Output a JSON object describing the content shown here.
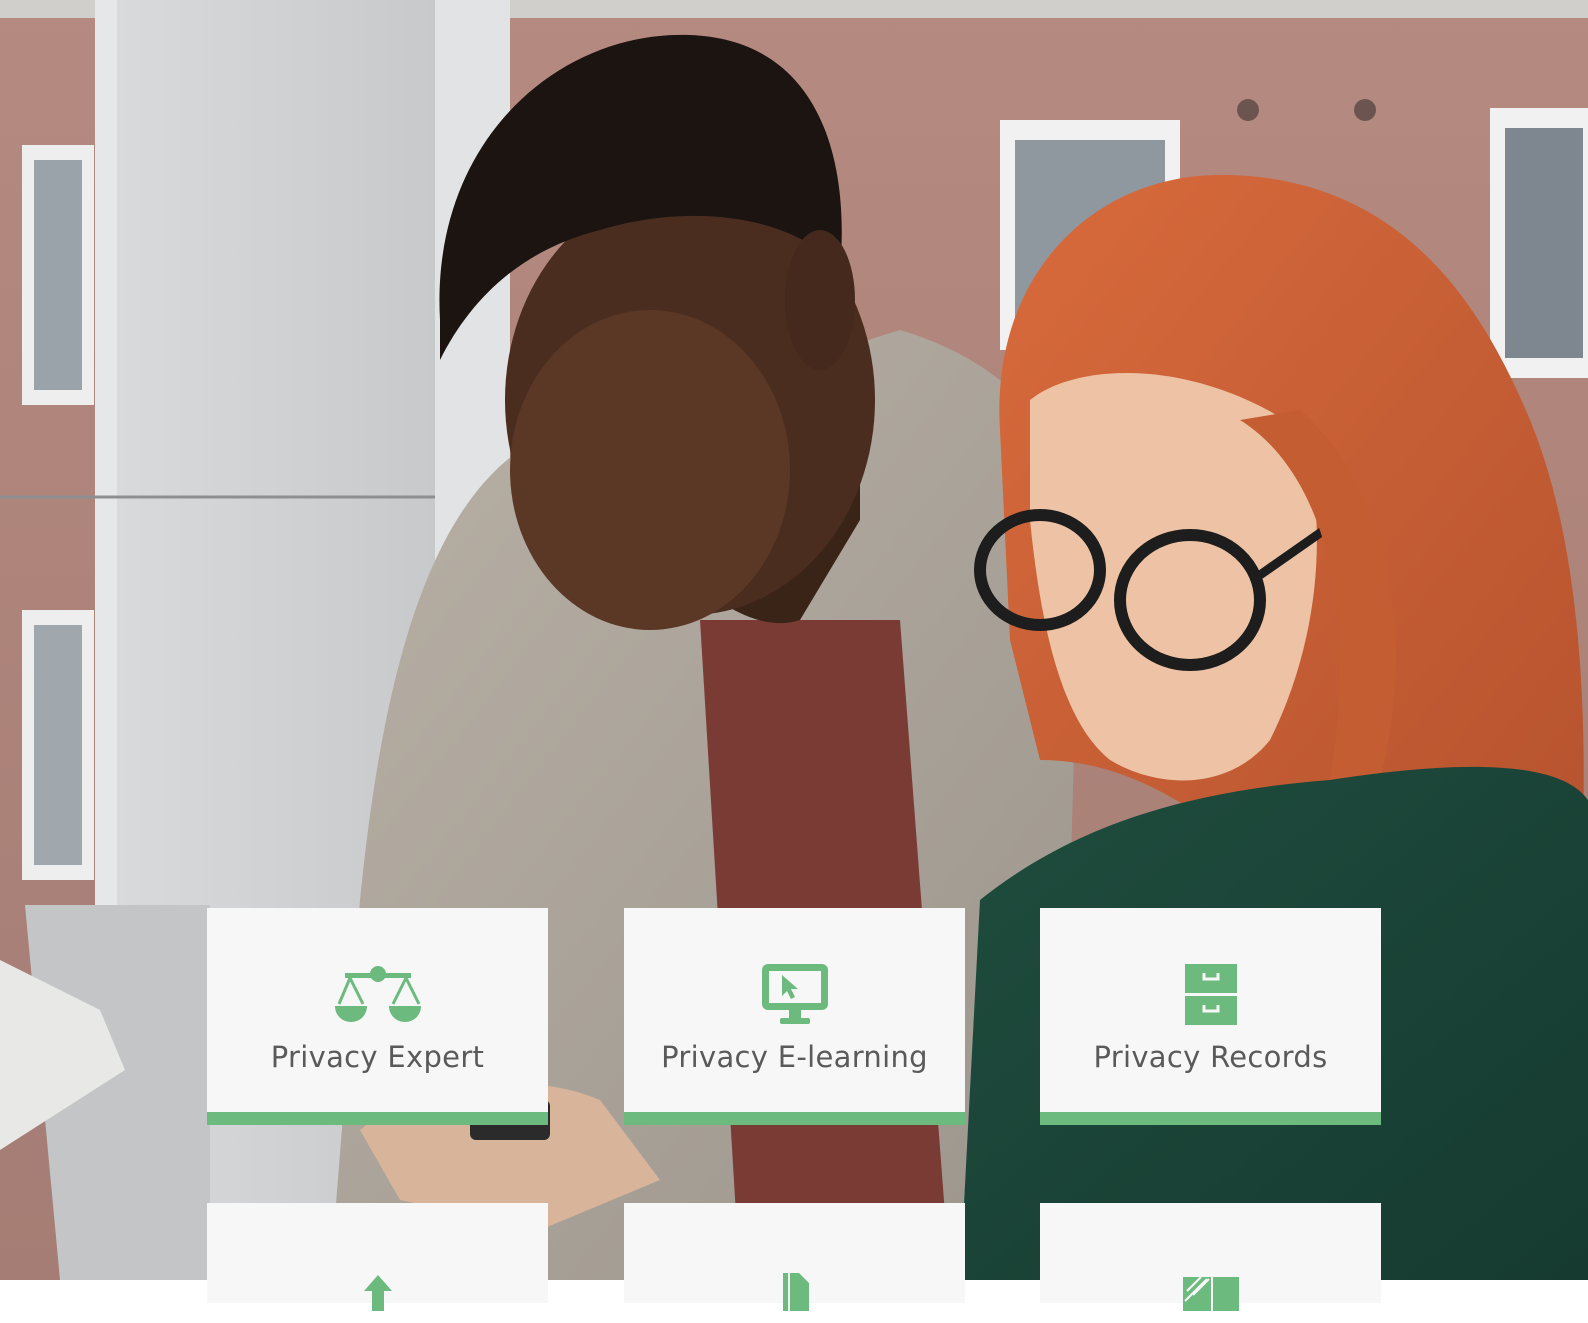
{
  "cards": [
    {
      "label": "Privacy Expert",
      "icon": "balance-scale-icon"
    },
    {
      "label": "Privacy E-learning",
      "icon": "monitor-cursor-icon"
    },
    {
      "label": "Privacy Records",
      "icon": "filing-cabinet-icon"
    },
    {
      "label": "",
      "icon": "arrow-up-icon"
    },
    {
      "label": "",
      "icon": "document-icon"
    },
    {
      "label": "",
      "icon": "striped-panel-icon"
    }
  ],
  "colors": {
    "accent": "#6dba7e",
    "card_background": "#f7f7f7",
    "label_text": "#5a5a5a"
  }
}
